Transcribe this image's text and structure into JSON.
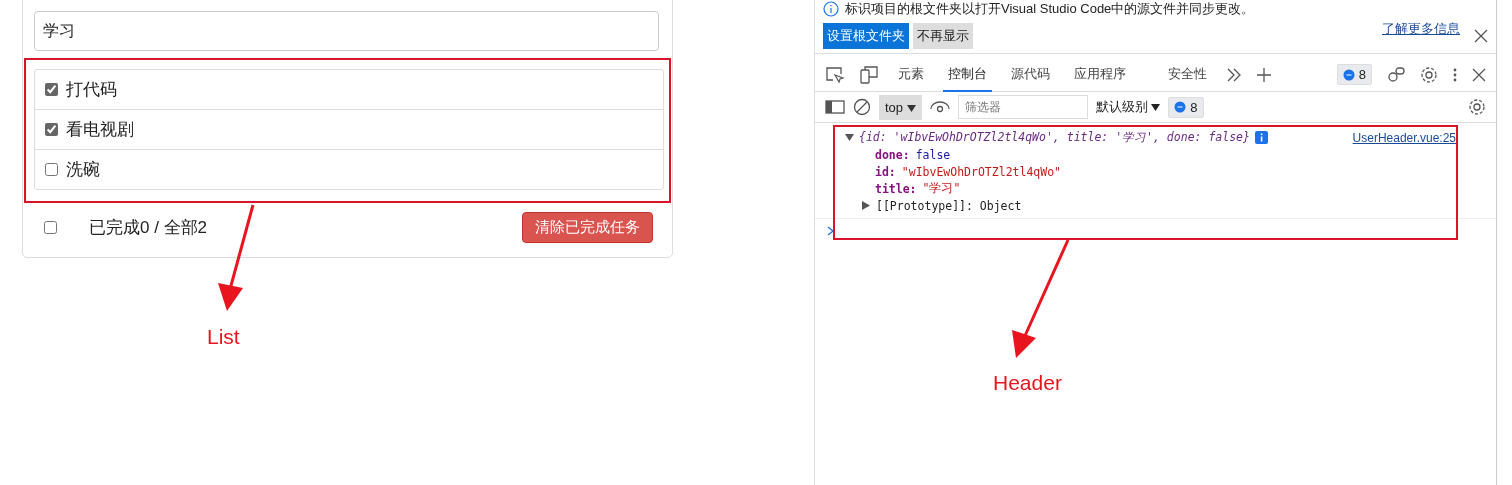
{
  "todo": {
    "input": {
      "value": "学习"
    },
    "items": [
      {
        "title": "打代码",
        "checked": true
      },
      {
        "title": "看电视剧",
        "checked": true
      },
      {
        "title": "洗碗",
        "checked": false
      }
    ],
    "footer": {
      "all_checked": false,
      "summary": "已完成0 / 全部2",
      "clear_button": "清除已完成任务"
    }
  },
  "devtools": {
    "infobar": {
      "message": "标识项目的根文件夹以打开Visual Studio Code中的源文件并同步更改。",
      "link": "了解更多信息",
      "buttons": [
        "设置根文件夹",
        "不再显示"
      ]
    },
    "tabs": [
      {
        "label": "元素",
        "selected": false
      },
      {
        "label": "控制台",
        "selected": true
      },
      {
        "label": "源代码",
        "selected": false
      },
      {
        "label": "应用程序",
        "selected": false
      },
      {
        "label": "安全性",
        "selected": false
      }
    ],
    "issues_count": "8",
    "console_toolbar": {
      "context": "top",
      "filter_placeholder": "筛选器",
      "level": "默认级别",
      "messages_count": "8"
    },
    "log": {
      "summary": "{id: 'wIbvEwOhDrOTZl2tl4qWo', title: '学习', done: false}",
      "source": "UserHeader.vue:25",
      "expanded": true,
      "properties": [
        {
          "key": "done:",
          "value": "false",
          "kind": "boolean"
        },
        {
          "key": "id:",
          "value": "\"wIbvEwOhDrOTZl2tl4qWo\"",
          "kind": "string"
        },
        {
          "key": "title:",
          "value": "\"学习\"",
          "kind": "string"
        }
      ],
      "prototype": "[[Prototype]]: Object"
    }
  },
  "annotations": [
    {
      "label": "List"
    },
    {
      "label": "Header"
    }
  ]
}
